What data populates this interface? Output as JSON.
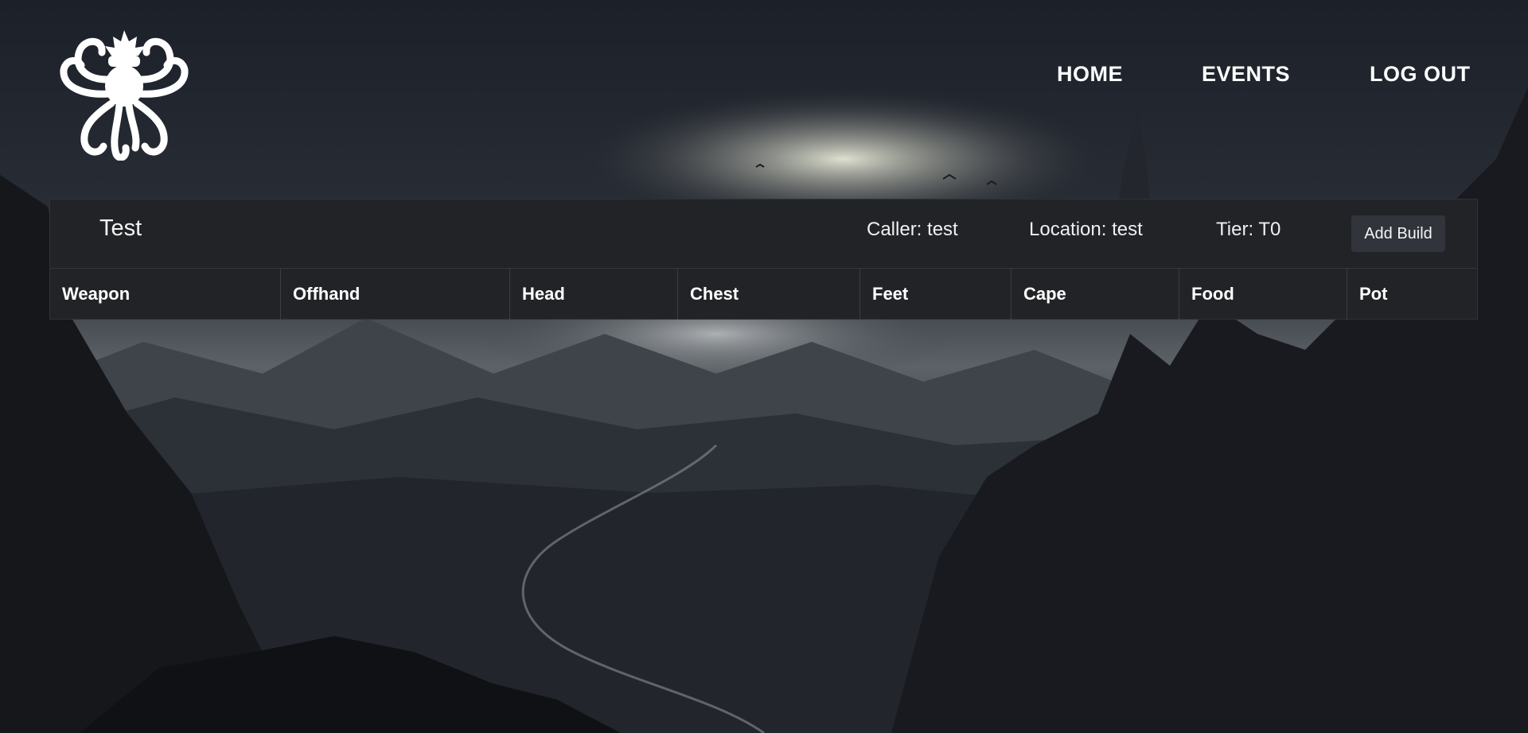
{
  "nav": {
    "items": [
      {
        "label": "HOME"
      },
      {
        "label": "EVENTS"
      },
      {
        "label": "LOG OUT"
      }
    ]
  },
  "logo": {
    "icon": "octopus-icon"
  },
  "event": {
    "title": "Test",
    "caller": "Caller: test",
    "location": "Location: test",
    "tier": "Tier: T0",
    "add_build_label": "Add Build"
  },
  "table": {
    "columns": [
      "Weapon",
      "Offhand",
      "Head",
      "Chest",
      "Feet",
      "Cape",
      "Food",
      "Pot"
    ]
  },
  "colors": {
    "panel": "#212327",
    "text": "#ffffff",
    "button": "#31353b"
  }
}
